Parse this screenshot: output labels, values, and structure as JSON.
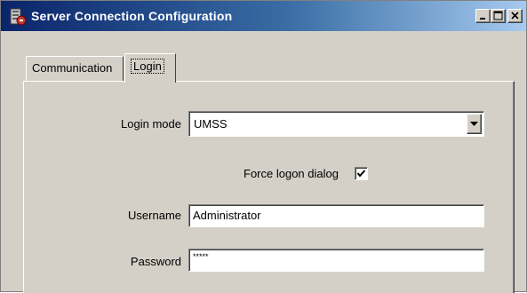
{
  "window": {
    "title": "Server Connection Configuration",
    "icon": "server-connection-icon",
    "caption_buttons": [
      "minimize-icon",
      "maximize-icon",
      "close-icon"
    ]
  },
  "tabs": [
    {
      "label": "Communication",
      "selected": false
    },
    {
      "label": "Login",
      "selected": true
    }
  ],
  "form": {
    "login_mode": {
      "label": "Login mode",
      "value": "UMSS"
    },
    "force_logon": {
      "label": "Force logon dialog",
      "checked": true
    },
    "username": {
      "label": "Username",
      "value": "Administrator"
    },
    "password": {
      "label": "Password",
      "value": "*****"
    }
  }
}
